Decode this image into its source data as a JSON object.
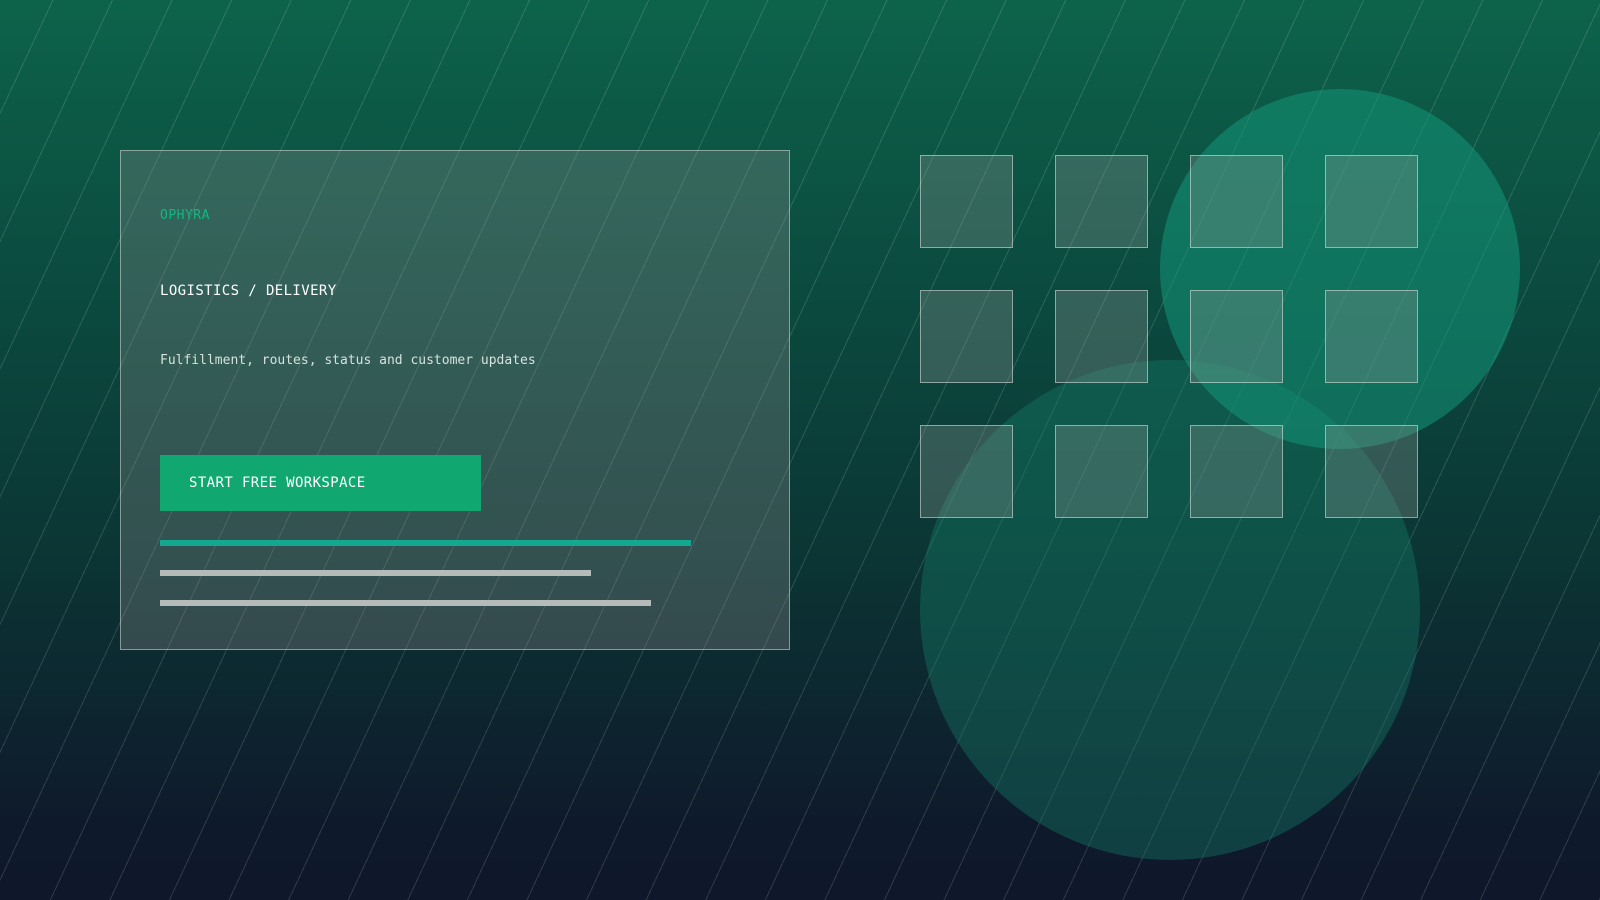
{
  "brand": {
    "name": "OPHYRA"
  },
  "hero": {
    "category": "LOGISTICS / DELIVERY",
    "tagline": "Fulfillment, routes, status and customer updates",
    "cta_label": "START FREE WORKSPACE"
  },
  "colors": {
    "accent": "#10b981",
    "button": "#10a870",
    "track_accent": "#14a890",
    "track_neutral": "#b4bbb8"
  },
  "decor": {
    "tile_grid_columns": 4,
    "tile_grid_rows": 3
  }
}
